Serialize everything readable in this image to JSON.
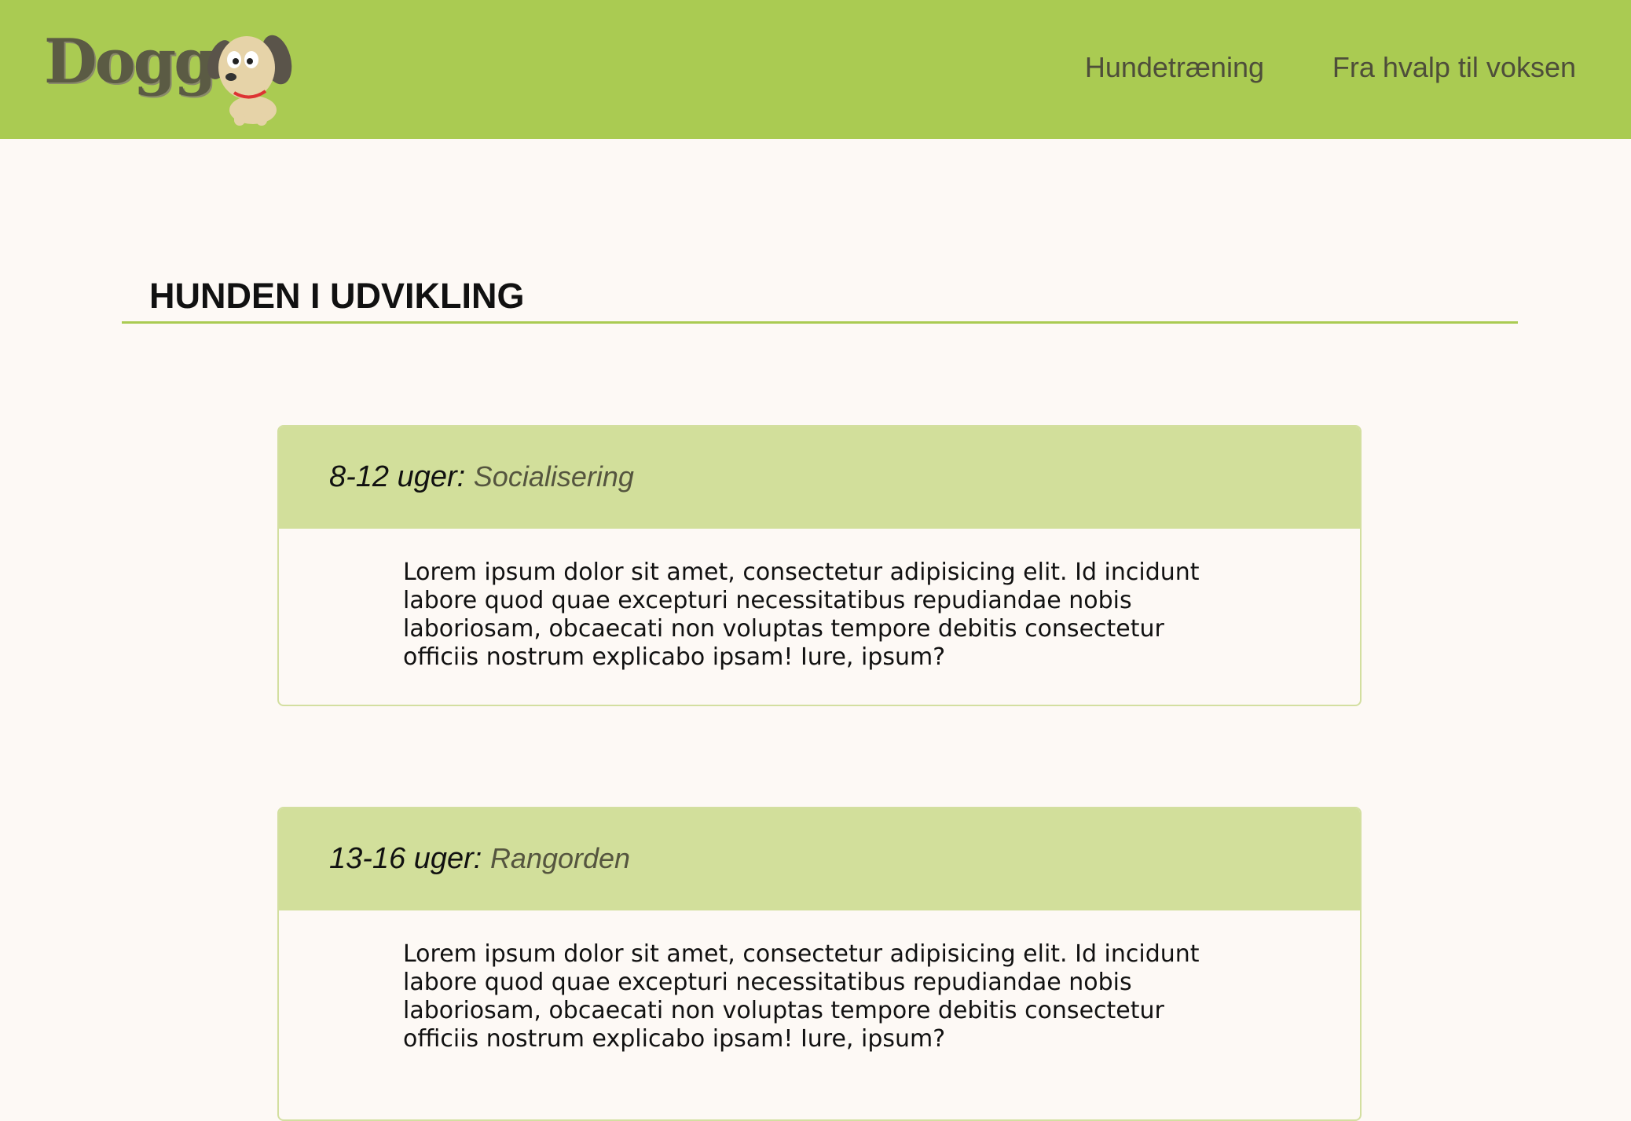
{
  "header": {
    "logo_text": "Dogg",
    "logo_icon": "dog-icon",
    "nav": [
      {
        "label": "Hundetræning"
      },
      {
        "label": "Fra hvalp til voksen"
      }
    ]
  },
  "main": {
    "title": "HUNDEN I UDVIKLING",
    "cards": [
      {
        "age": "8-12 uger:",
        "topic": "Socialisering",
        "body": "Lorem ipsum dolor sit amet, consectetur adipisicing elit. Id incidunt labore quod quae excepturi necessitatibus repudiandae nobis laboriosam, obcaecati non voluptas tempore debitis consectetur officiis nostrum explicabo ipsam! Iure, ipsum?"
      },
      {
        "age": "13-16 uger:",
        "topic": "Rangorden",
        "body": "Lorem ipsum dolor sit amet, consectetur adipisicing elit. Id incidunt labore quod quae excepturi necessitatibus repudiandae nobis laboriosam, obcaecati non voluptas tempore debitis consectetur officiis nostrum explicabo ipsam! Iure, ipsum?"
      }
    ]
  },
  "colors": {
    "header_bg": "#aacb52",
    "card_header_bg": "#d2df9b",
    "page_bg": "#fdf9f5",
    "accent_rule": "#aacb52"
  }
}
